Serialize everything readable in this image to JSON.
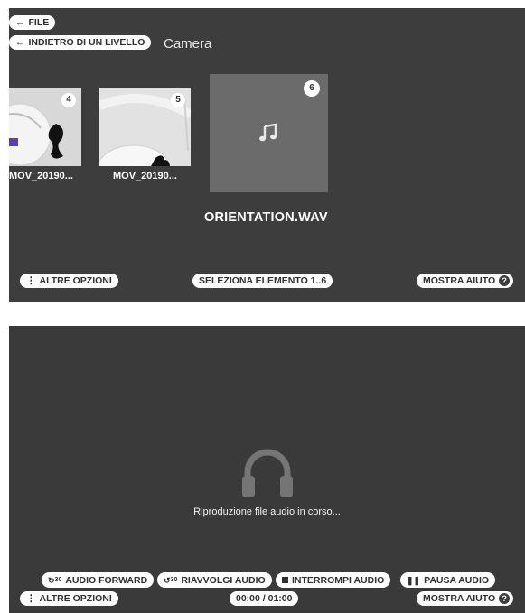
{
  "browser": {
    "file_button": "FILE",
    "back_level_button": "INDIETRO DI UN LIVELLO",
    "folder_title": "Camera",
    "items": [
      {
        "index": "4",
        "label": "MOV_20190..."
      },
      {
        "index": "5",
        "label": "MOV_20190..."
      },
      {
        "index": "6",
        "label": "ORIENTATION.WAV"
      }
    ],
    "more_options": "ALTRE OPZIONI",
    "select_item": "SELEZIONA ELEMENTO 1..6",
    "show_help": "MOSTRA AIUTO",
    "help_symbol": "?"
  },
  "player": {
    "status": "Riproduzione file audio in corso...",
    "forward_icon_text": "30",
    "rewind_icon_text": "30",
    "controls": {
      "forward": "AUDIO FORWARD",
      "rewind": "RIAVVOLGI AUDIO",
      "stop": "INTERROMPI AUDIO",
      "pause": "PAUSA AUDIO"
    },
    "more_options": "ALTRE OPZIONI",
    "time": "00:00 / 01:00",
    "show_help": "MOSTRA AIUTO",
    "help_symbol": "?"
  },
  "colors": {
    "panel_bg": "#3d3d3d",
    "pill_bg": "#ffffff",
    "audio_tile_bg": "#6b6b6b"
  }
}
